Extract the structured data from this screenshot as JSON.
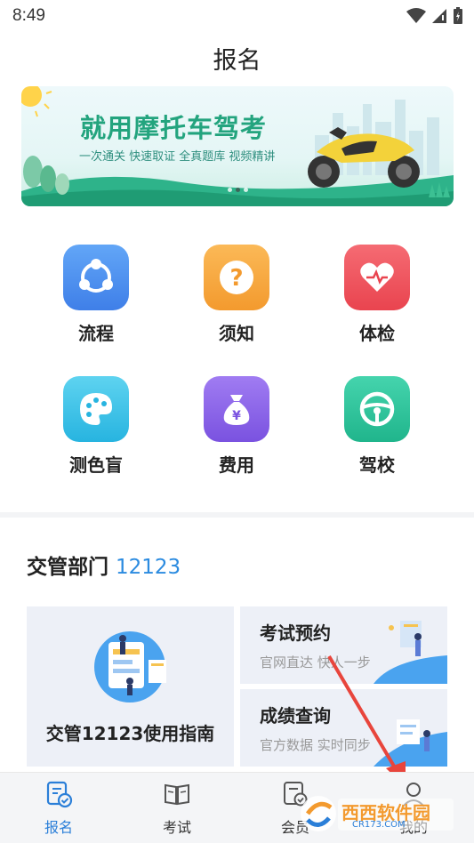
{
  "status_bar": {
    "time": "8:49"
  },
  "page": {
    "title": "报名"
  },
  "banner": {
    "headline": "就用摩托车驾考",
    "subline": "一次通关 快速取证   全真题库 视频精讲"
  },
  "menu": {
    "items": [
      {
        "label": "流程",
        "icon": "share-nodes-icon",
        "color": "#4b8ef0"
      },
      {
        "label": "须知",
        "icon": "question-icon",
        "color": "#f7a53a"
      },
      {
        "label": "体检",
        "icon": "heart-icon",
        "color": "#f0565f"
      },
      {
        "label": "测色盲",
        "icon": "palette-icon",
        "color": "#36c3e6"
      },
      {
        "label": "费用",
        "icon": "money-bag-icon",
        "color": "#8a63e8"
      },
      {
        "label": "驾校",
        "icon": "steering-wheel-icon",
        "color": "#2ec59e"
      }
    ]
  },
  "section": {
    "title": "交管部门",
    "number": "12123"
  },
  "cards": {
    "guide": {
      "label": "交管12123使用指南"
    },
    "booking": {
      "title": "考试预约",
      "subtitle": "官网直达 快人一步"
    },
    "score": {
      "title": "成绩查询",
      "subtitle": "官方数据 实时同步"
    }
  },
  "tabbar": {
    "items": [
      {
        "label": "报名",
        "active": true
      },
      {
        "label": "考试",
        "active": false
      },
      {
        "label": "会员",
        "active": false
      },
      {
        "label": "我的",
        "active": false
      }
    ]
  },
  "watermark": {
    "text": "西西软件园",
    "url_text": "CR173.COM"
  },
  "colors": {
    "accent": "#2b7fd8",
    "brand_green": "#23a47e",
    "arrow": "#e8453c"
  }
}
